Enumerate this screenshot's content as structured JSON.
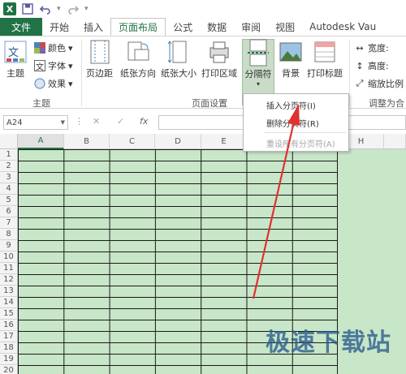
{
  "qat": {
    "icons": [
      "excel-app-icon",
      "save-icon",
      "undo-icon",
      "redo-icon"
    ]
  },
  "tabs": [
    {
      "label": "文件"
    },
    {
      "label": "开始"
    },
    {
      "label": "插入"
    },
    {
      "label": "页面布局"
    },
    {
      "label": "公式"
    },
    {
      "label": "数据"
    },
    {
      "label": "审阅"
    },
    {
      "label": "视图"
    },
    {
      "label": "Autodesk Vau"
    }
  ],
  "ribbon": {
    "theme_group": {
      "label": "主题",
      "theme_btn": "主题",
      "colors_btn": "颜色",
      "fonts_btn": "字体",
      "effects_btn": "效果"
    },
    "page_setup_group": {
      "label": "页面设置",
      "margins": "页边距",
      "orientation": "纸张方向",
      "size": "纸张大小",
      "print_area": "打印区域",
      "breaks": "分隔符",
      "background": "背景",
      "print_titles": "打印标题"
    },
    "scale_group": {
      "label": "调整为合",
      "width": "宽度:",
      "height": "高度:",
      "scale": "缩放比例"
    }
  },
  "breaks_menu": {
    "items": [
      {
        "label": "插入分页符(I)",
        "enabled": true
      },
      {
        "label": "删除分页符(R)",
        "enabled": true
      },
      {
        "label": "重设所有分页符(A)",
        "enabled": false
      }
    ]
  },
  "formula_bar": {
    "name_box": "A24",
    "fx_label": "fx"
  },
  "grid": {
    "columns": [
      "A",
      "B",
      "C",
      "D",
      "E",
      "F",
      "G",
      "H"
    ],
    "rows": [
      "1",
      "2",
      "3",
      "4",
      "5",
      "6",
      "7",
      "8",
      "9",
      "10",
      "11",
      "12",
      "13",
      "14",
      "15",
      "16",
      "17",
      "18",
      "19",
      "20"
    ],
    "fill_color": "#c8e6c8"
  },
  "watermark": {
    "text": "极速下载站"
  }
}
